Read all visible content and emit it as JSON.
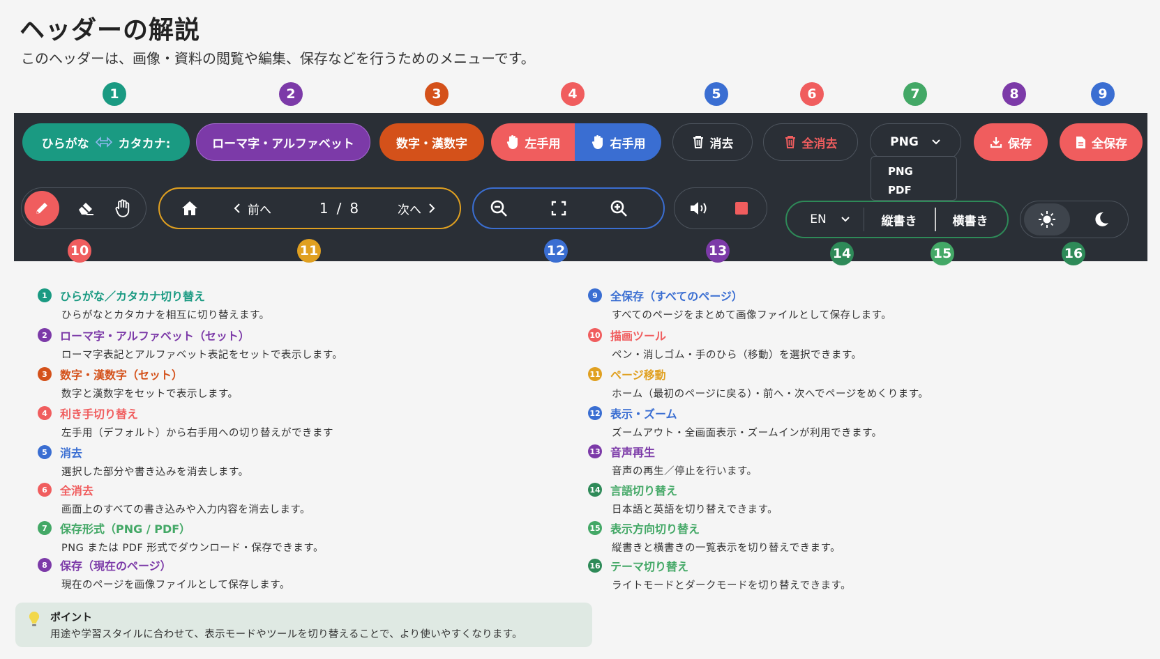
{
  "title": "ヘッダーの解説",
  "subtitle": "このヘッダーは、画像・資料の閲覧や編集、保存などを行うためのメニューです。",
  "colors": {
    "toolbar_bg": "#2a2f36",
    "teal": "#1a9a82",
    "purple": "#7c3aa8",
    "orange": "#d4511a",
    "coral": "#f05d5e",
    "blue": "#3a6ed2",
    "green": "#43a866"
  },
  "toolbar": {
    "kana_hiragana": "ひらがな",
    "kana_katakana": "カタカナ:",
    "romaji": "ローマ字・アルファベット",
    "kanji_num": "数字・漢数字",
    "left_hand": "左手用",
    "right_hand": "右手用",
    "erase": "消去",
    "erase_all": "全消去",
    "format_value": "PNG",
    "format_options": [
      "PNG",
      "PDF"
    ],
    "save": "保存",
    "save_all": "全保存",
    "prev": "前へ",
    "page_current": "1",
    "page_sep": "/",
    "page_total": "8",
    "next": "次へ",
    "lang_value": "EN",
    "vertical": "縦書き",
    "horizontal": "横書き"
  },
  "numbers": [
    "1",
    "2",
    "3",
    "4",
    "5",
    "6",
    "7",
    "8",
    "9",
    "10",
    "11",
    "12",
    "13",
    "14",
    "15",
    "16"
  ],
  "descriptions_left": [
    {
      "num": "1",
      "title": "ひらがな／カタカナ切り替え",
      "text": "ひらがなとカタカナを相互に切り替えます。"
    },
    {
      "num": "2",
      "title": "ローマ字・アルファベット（セット）",
      "text": "ローマ字表記とアルファベット表記をセットで表示します。"
    },
    {
      "num": "3",
      "title": "数字・漢数字（セット）",
      "text": "数字と漢数字をセットで表示します。"
    },
    {
      "num": "4",
      "title": "利き手切り替え",
      "text": "左手用（デフォルト）から右手用への切り替えができます"
    },
    {
      "num": "5",
      "title": "消去",
      "text": "選択した部分や書き込みを消去します。"
    },
    {
      "num": "6",
      "title": "全消去",
      "text": "画面上のすべての書き込みや入力内容を消去します。"
    },
    {
      "num": "7",
      "title": "保存形式（PNG / PDF）",
      "text": "PNG または PDF  形式でダウンロード・保存できます。"
    },
    {
      "num": "8",
      "title": "保存（現在のページ）",
      "text": "現在のページを画像ファイルとして保存します。"
    }
  ],
  "descriptions_right": [
    {
      "num": "9",
      "title": "全保存（すべてのページ）",
      "text": "すべてのページをまとめて画像ファイルとして保存します。"
    },
    {
      "num": "10",
      "title": "描画ツール",
      "text": "ペン・消しゴム・手のひら（移動）を選択できます。"
    },
    {
      "num": "11",
      "title": "ページ移動",
      "text": "ホーム（最初のページに戻る）・前へ・次へでページをめくります。"
    },
    {
      "num": "12",
      "title": "表示・ズーム",
      "text": "ズームアウト・全画面表示・ズームインが利用できます。"
    },
    {
      "num": "13",
      "title": "音声再生",
      "text": "音声の再生／停止を行います。"
    },
    {
      "num": "14",
      "title": "言語切り替え",
      "text": "日本語と英語を切り替えできます。"
    },
    {
      "num": "15",
      "title": "表示方向切り替え",
      "text": "縦書きと横書きの一覧表示を切り替えできます。"
    },
    {
      "num": "16",
      "title": "テーマ切り替え",
      "text": "ライトモードとダークモードを切り替えできます。"
    }
  ],
  "point": {
    "title": "ポイント",
    "text": "用途や学習スタイルに合わせて、表示モードやツールを切り替えることで、より使いやすくなります。"
  }
}
